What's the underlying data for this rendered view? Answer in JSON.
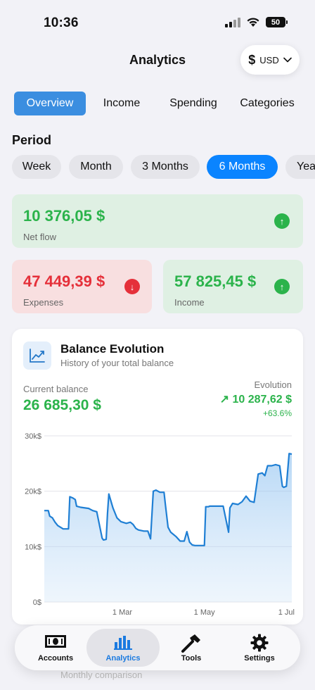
{
  "status": {
    "time": "10:36",
    "battery": "50"
  },
  "header": {
    "title": "Analytics",
    "currency_symbol": "$",
    "currency_code": "USD"
  },
  "tabs": [
    {
      "label": "Overview",
      "active": true
    },
    {
      "label": "Income",
      "active": false
    },
    {
      "label": "Spending",
      "active": false
    },
    {
      "label": "Categories",
      "active": false
    }
  ],
  "period": {
    "title": "Period",
    "options": [
      "Week",
      "Month",
      "3 Months",
      "6 Months",
      "Year"
    ],
    "selected": "6 Months"
  },
  "stats": {
    "net_flow": {
      "value": "10 376,05 $",
      "label": "Net flow",
      "trend": "up",
      "color": "#2bb34b"
    },
    "expenses": {
      "value": "47 449,39 $",
      "label": "Expenses",
      "trend": "down",
      "color": "#e5303a"
    },
    "income": {
      "value": "57 825,45 $",
      "label": "Income",
      "trend": "up",
      "color": "#2bb34b"
    }
  },
  "balance_card": {
    "title": "Balance Evolution",
    "subtitle": "History of your total balance",
    "current_label": "Current balance",
    "current_value": "26 685,30 $",
    "evolution_label": "Evolution",
    "evolution_value": "↗ 10 287,62 $",
    "evolution_pct": "+63.6%"
  },
  "chart_data": {
    "type": "area",
    "y_ticks": [
      "30k$",
      "20k$",
      "10k$",
      "0$"
    ],
    "ylim": [
      0,
      30000
    ],
    "x_ticks": [
      {
        "label": "1 Mar",
        "day": 59
      },
      {
        "label": "1 May",
        "day": 120
      },
      {
        "label": "1 Jul",
        "day": 181
      }
    ],
    "xlim": [
      1,
      185
    ],
    "series": [
      {
        "x": [
          1,
          4,
          5,
          7,
          9,
          11,
          15,
          19,
          20,
          22,
          24,
          25,
          28,
          34,
          37,
          40,
          44,
          45,
          47,
          48,
          49,
          52,
          55,
          58,
          62,
          65,
          67,
          69,
          71,
          75,
          78,
          80,
          82,
          84,
          87,
          90,
          91,
          93,
          95,
          99,
          102,
          105,
          107,
          109,
          111,
          113,
          114,
          116,
          120,
          121,
          123,
          124,
          127,
          134,
          138,
          139,
          141,
          145,
          148,
          151,
          154,
          157,
          160,
          163,
          165,
          167,
          170,
          173,
          176,
          178,
          179,
          181,
          183,
          185
        ],
        "y": [
          16500,
          16500,
          15500,
          15200,
          14400,
          13800,
          13200,
          13200,
          19000,
          18800,
          18500,
          17300,
          17100,
          16900,
          16500,
          16300,
          11500,
          11200,
          11300,
          16000,
          19500,
          17000,
          15200,
          14500,
          14200,
          14400,
          14000,
          13300,
          13000,
          12800,
          12800,
          11400,
          20000,
          20200,
          19800,
          19800,
          17600,
          13500,
          12600,
          11800,
          11000,
          11000,
          12700,
          10800,
          10300,
          10200,
          10200,
          10200,
          10200,
          17200,
          17200,
          17300,
          17300,
          17300,
          12600,
          17000,
          17800,
          17600,
          18100,
          19100,
          18200,
          18000,
          23100,
          23300,
          22800,
          24600,
          24600,
          24800,
          24600,
          20900,
          20700,
          20900,
          26800,
          26700
        ]
      }
    ],
    "line_color": "#1f7fd4"
  },
  "partial_card": {
    "subtitle": "Monthly comparison"
  },
  "tabbar": [
    {
      "label": "Accounts",
      "icon": "banknote-icon",
      "active": false
    },
    {
      "label": "Analytics",
      "icon": "bar-chart-icon",
      "active": true
    },
    {
      "label": "Tools",
      "icon": "hammer-icon",
      "active": false
    },
    {
      "label": "Settings",
      "icon": "gear-icon",
      "active": false
    }
  ]
}
